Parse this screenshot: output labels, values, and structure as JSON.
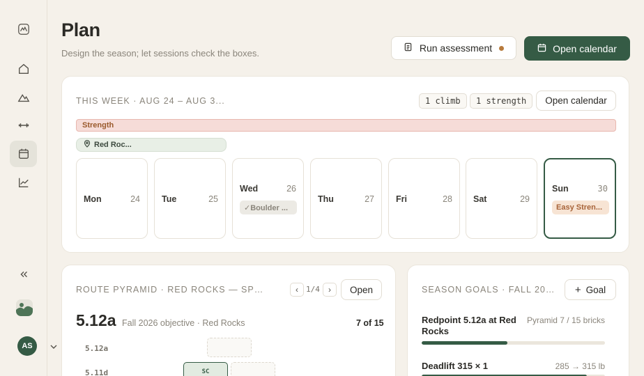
{
  "sidebar": {
    "icons": [
      "logo-icon",
      "home-icon",
      "mountain-icon",
      "dumbbell-icon",
      "calendar-icon",
      "chart-icon",
      "collapse-icon"
    ],
    "active": "calendar-icon",
    "user_initials": "AS"
  },
  "header": {
    "title": "Plan",
    "subtitle": "Design the season; let sessions check the boxes.",
    "run_assessment_label": "Run assessment",
    "open_calendar_label": "Open calendar"
  },
  "week": {
    "label": "THIS WEEK · AUG 24 – AUG 3...",
    "chip_climb": "1 climb",
    "chip_strength": "1 strength",
    "open_calendar_label": "Open calendar",
    "strength_banner": "Strength",
    "location_banner": "Red Roc...",
    "days": [
      {
        "name": "Mon",
        "num": "24",
        "chip": ""
      },
      {
        "name": "Tue",
        "num": "25",
        "chip": ""
      },
      {
        "name": "Wed",
        "num": "26",
        "chip": "✓Boulder ..."
      },
      {
        "name": "Thu",
        "num": "27",
        "chip": ""
      },
      {
        "name": "Fri",
        "num": "28",
        "chip": ""
      },
      {
        "name": "Sat",
        "num": "29",
        "chip": ""
      },
      {
        "name": "Sun",
        "num": "30",
        "chip": "Easy Stren..."
      }
    ]
  },
  "pyramid": {
    "label": "ROUTE PYRAMID · RED ROCKS — SPOR...",
    "pager": "1/4",
    "open_label": "Open",
    "grade": "5.12a",
    "grade_sub": "Fall 2026 objective · Red Rocks",
    "count": "7 of 15",
    "rows": [
      {
        "grade": "5.12a"
      },
      {
        "grade": "5.11d",
        "brick_label": "SC"
      }
    ]
  },
  "goals": {
    "label": "SEASON GOALS · FALL 2026...",
    "add_label": "Goal",
    "items": [
      {
        "title": "Redpoint 5.12a at Red Rocks",
        "meta": "Pyramid 7 / 15 bricks",
        "progress": 0.467
      },
      {
        "title": "Deadlift 315 × 1",
        "meta": "285 → 315 lb",
        "progress": 0.9
      }
    ]
  },
  "colors": {
    "accent": "#355b45",
    "background": "#f5f1ea",
    "strength": "#f6dcd8",
    "dot": "#b77a3c"
  }
}
